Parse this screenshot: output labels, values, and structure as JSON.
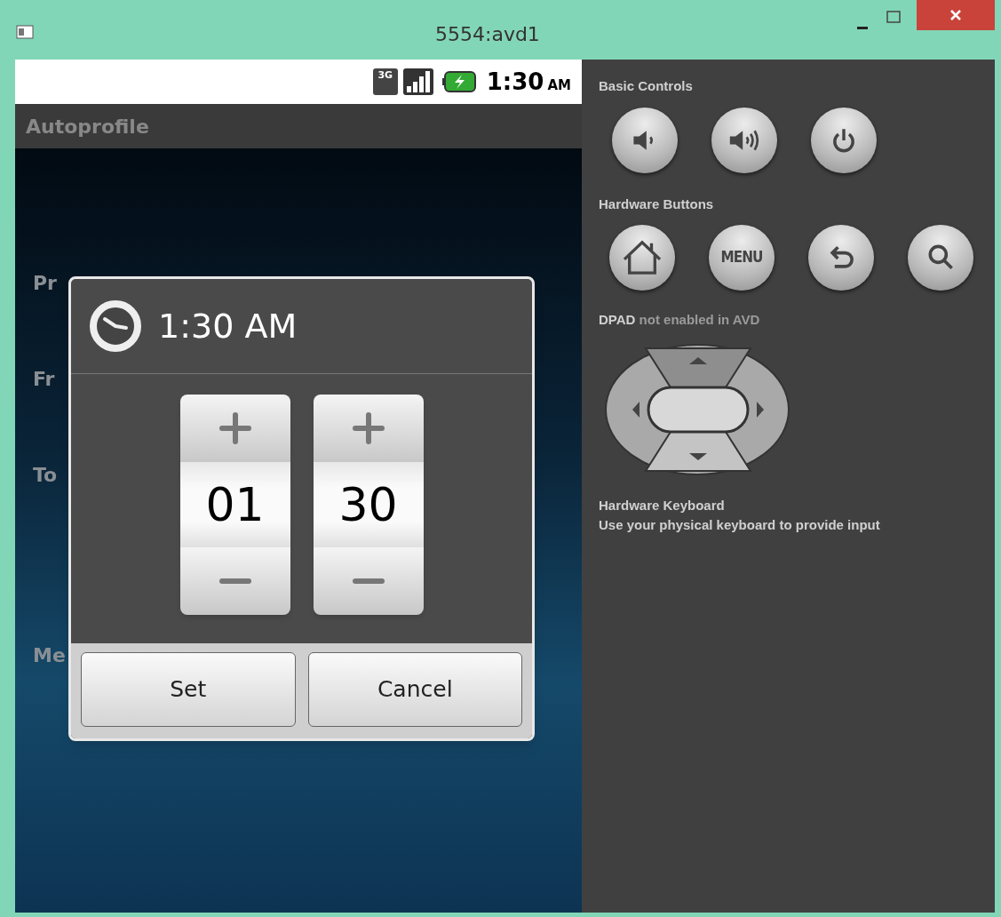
{
  "window": {
    "title": "5554:avd1"
  },
  "status_bar": {
    "network": "3G",
    "time": "1:30",
    "meridiem": "AM"
  },
  "app": {
    "title": "Autoprofile",
    "labels": [
      "Pr",
      "Fr",
      "To",
      "Me"
    ]
  },
  "time_dialog": {
    "title": "1:30 AM",
    "pickers": [
      {
        "value": "01"
      },
      {
        "value": "30"
      }
    ],
    "buttons": [
      "Set",
      "Cancel"
    ]
  },
  "controls": {
    "basic_title": "Basic Controls",
    "basic_buttons": [
      {
        "kind": "volume-down"
      },
      {
        "kind": "volume-up"
      },
      {
        "kind": "power"
      }
    ],
    "hardware_title": "Hardware Buttons",
    "hardware_buttons": [
      {
        "kind": "home"
      },
      {
        "kind": "menu",
        "label": "MENU"
      },
      {
        "kind": "back"
      },
      {
        "kind": "search"
      }
    ],
    "dpad_note": "**DPAD** not enabled in AVD",
    "keyboard_title": "Hardware Keyboard",
    "keyboard_text": "Use your physical keyboard to provide input"
  }
}
